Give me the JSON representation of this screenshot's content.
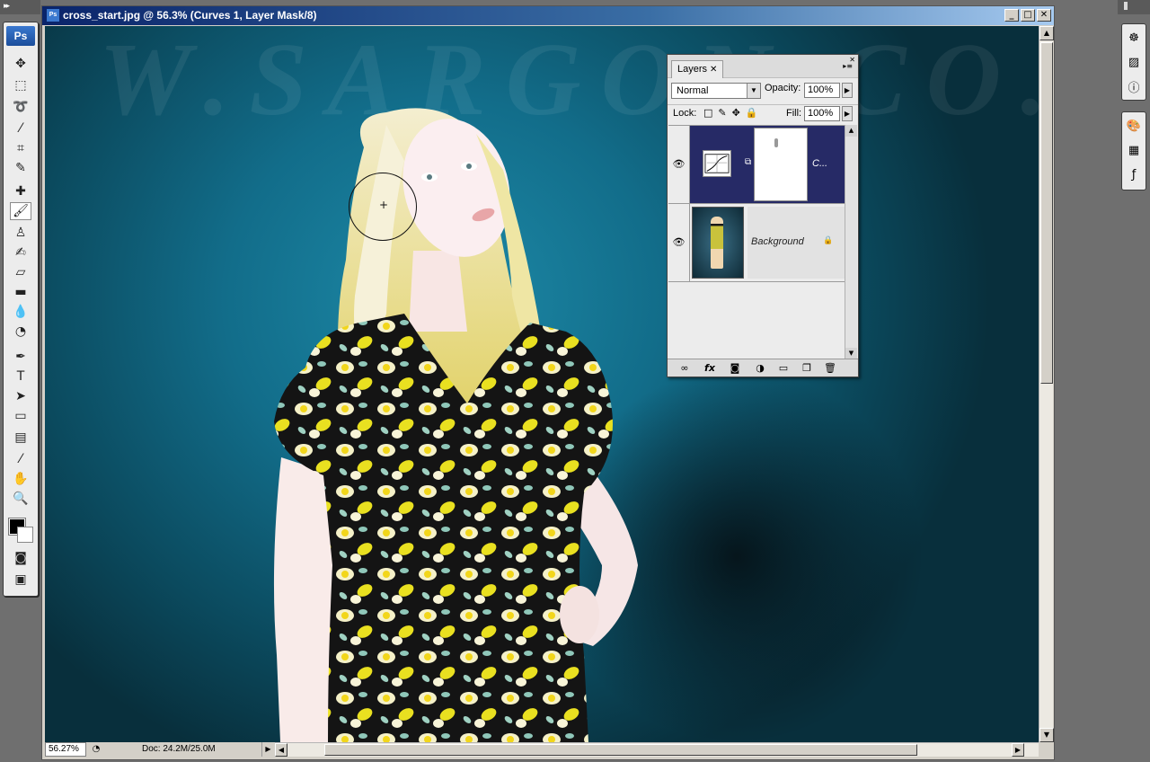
{
  "toolbox": {
    "logo": "Ps",
    "tools": [
      {
        "name": "move-tool",
        "glyph": "✥"
      },
      {
        "name": "marquee-tool",
        "glyph": "⬚"
      },
      {
        "name": "lasso-tool",
        "glyph": "➰"
      },
      {
        "name": "magic-wand-tool",
        "glyph": "⁄"
      },
      {
        "name": "crop-tool",
        "glyph": "⌗"
      },
      {
        "name": "slice-tool",
        "glyph": "✎"
      },
      {
        "name": "healing-brush-tool",
        "glyph": "✚"
      },
      {
        "name": "brush-tool",
        "glyph": "🖌"
      },
      {
        "name": "clone-stamp-tool",
        "glyph": "♙"
      },
      {
        "name": "history-brush-tool",
        "glyph": "✍"
      },
      {
        "name": "eraser-tool",
        "glyph": "▱"
      },
      {
        "name": "gradient-tool",
        "glyph": "▬"
      },
      {
        "name": "blur-tool",
        "glyph": "💧"
      },
      {
        "name": "dodge-tool",
        "glyph": "◔"
      },
      {
        "name": "pen-tool",
        "glyph": "✒"
      },
      {
        "name": "type-tool",
        "glyph": "T"
      },
      {
        "name": "path-selection-tool",
        "glyph": "➤"
      },
      {
        "name": "shape-tool",
        "glyph": "▭"
      },
      {
        "name": "notes-tool",
        "glyph": "▤"
      },
      {
        "name": "eyedropper-tool",
        "glyph": "⁄"
      },
      {
        "name": "hand-tool",
        "glyph": "✋"
      },
      {
        "name": "zoom-tool",
        "glyph": "🔍"
      }
    ]
  },
  "document": {
    "title": "cross_start.jpg @ 56.3% (Curves 1, Layer Mask/8)",
    "watermark": "W.SARGON.CO.C",
    "zoom": "56.27%",
    "doc_info": "Doc: 24.2M/25.0M"
  },
  "layers_panel": {
    "tab_label": "Layers",
    "blend_mode": "Normal",
    "opacity_label": "Opacity:",
    "opacity_value": "100%",
    "lock_label": "Lock:",
    "fill_label": "Fill:",
    "fill_value": "100%",
    "layers": [
      {
        "name": "C...",
        "selected": true
      },
      {
        "name": "Background",
        "selected": false
      }
    ]
  },
  "colors": {
    "selected_layer": "#262a66",
    "title_bar_start": "#0a246a",
    "backdrop": "#126d8a"
  },
  "dock_icons": [
    "navigator-icon",
    "histogram-icon",
    "info-icon",
    "brushes-icon",
    "swatches-icon",
    "styles-icon"
  ]
}
